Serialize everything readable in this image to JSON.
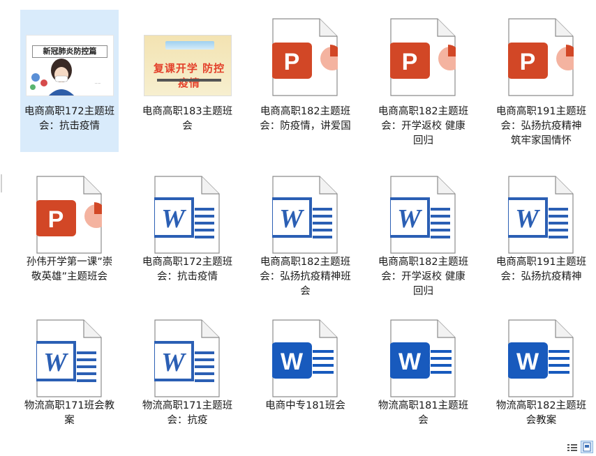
{
  "files": [
    {
      "name": "电商高职172主题班会：抗击疫情",
      "type": "thumb-covid",
      "selected": true
    },
    {
      "name": "电商高职183主题班会",
      "type": "thumb-school"
    },
    {
      "name": "电商高职182主题班会：防疫情，讲爱国",
      "type": "ppt"
    },
    {
      "name": "电商高职182主题班会：开学返校 健康回归",
      "type": "ppt"
    },
    {
      "name": "电商高职191主题班会：弘扬抗疫精神 筑牢家国情怀",
      "type": "ppt"
    },
    {
      "name": "孙伟开学第一课”崇敬英雄”主题班会",
      "type": "ppt"
    },
    {
      "name": "电商高职172主题班会：抗击疫情",
      "type": "word-old"
    },
    {
      "name": "电商高职182主题班会：弘扬抗疫精神班会",
      "type": "word-old"
    },
    {
      "name": "电商高职182主题班会：开学返校 健康回归",
      "type": "word-old"
    },
    {
      "name": "电商高职191主题班会：弘扬抗疫精神",
      "type": "word-old"
    },
    {
      "name": "物流高职171班会教案",
      "type": "word-old"
    },
    {
      "name": "物流高职171主题班会：抗疫",
      "type": "word-old"
    },
    {
      "name": "电商中专181班会",
      "type": "word-new"
    },
    {
      "name": "物流高职181主题班会",
      "type": "word-new"
    },
    {
      "name": "物流高职182主题班会教案",
      "type": "word-new"
    }
  ],
  "thumbs": {
    "covid_banner": "新冠肺炎防控篇",
    "school_banner": "复课开学 防控疫情"
  },
  "icons": {
    "ppt_letter": "P",
    "word_letter": "W"
  },
  "colors": {
    "ppt": "#d24726",
    "ppt_accent": "#f4b3a0",
    "word_old": "#2b5fb4",
    "word_new": "#185abd",
    "selection": "#d9ebfb"
  },
  "status": {
    "details_view": "details-view-icon",
    "large_icons_view": "large-icons-view-icon"
  }
}
